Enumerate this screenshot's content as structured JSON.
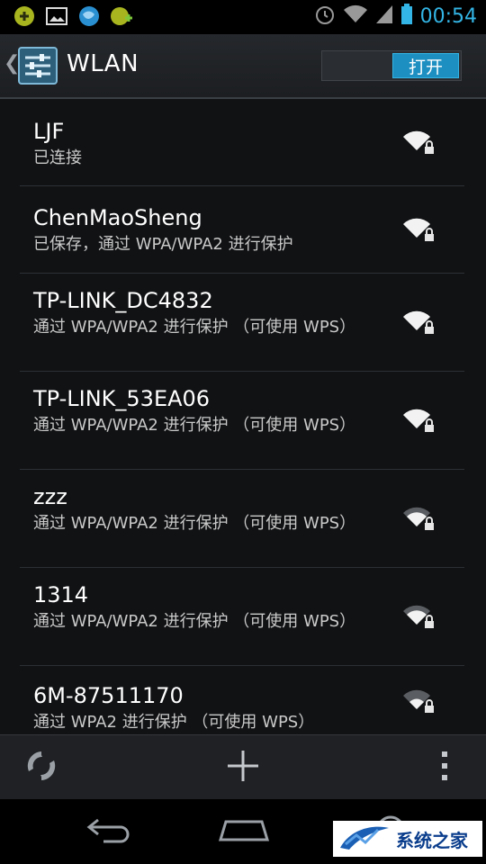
{
  "status_bar": {
    "time": "00:54",
    "left_icons": [
      "sync-app-icon",
      "gallery-notification-icon",
      "globe-notification-icon",
      "download-notification-icon"
    ],
    "right_icons": [
      "alarm-icon",
      "wifi-signal-icon",
      "cell-signal-icon",
      "battery-icon"
    ],
    "accent_color": "#33b5e5"
  },
  "action_bar": {
    "title": "WLAN",
    "toggle_label": "打开",
    "toggle_on": true
  },
  "networks": [
    {
      "ssid": "LJF",
      "status": "已连接",
      "signal": 4,
      "secured": true
    },
    {
      "ssid": "ChenMaoSheng",
      "status": "已保存，通过 WPA/WPA2 进行保护",
      "signal": 4,
      "secured": true
    },
    {
      "ssid": "TP-LINK_DC4832",
      "status": "通过 WPA/WPA2 进行保护 （可使用 WPS）",
      "signal": 4,
      "secured": true
    },
    {
      "ssid": "TP-LINK_53EA06",
      "status": "通过 WPA/WPA2 进行保护 （可使用 WPS）",
      "signal": 4,
      "secured": true
    },
    {
      "ssid": "zzz",
      "status": "通过 WPA/WPA2 进行保护 （可使用 WPS）",
      "signal": 3,
      "secured": true
    },
    {
      "ssid": "1314",
      "status": "通过 WPA/WPA2 进行保护 （可使用 WPS）",
      "signal": 3,
      "secured": true
    },
    {
      "ssid": "6M-87511170",
      "status": "通过 WPA2 进行保护 （可使用 WPS）",
      "signal": 2,
      "secured": true
    }
  ],
  "bottom_bar": {
    "icons": [
      "wps-icon",
      "add-network-icon",
      "overflow-menu-icon"
    ]
  },
  "nav_bar": {
    "icons": [
      "back-icon",
      "home-icon"
    ]
  },
  "watermark": {
    "text": "系统之家"
  }
}
